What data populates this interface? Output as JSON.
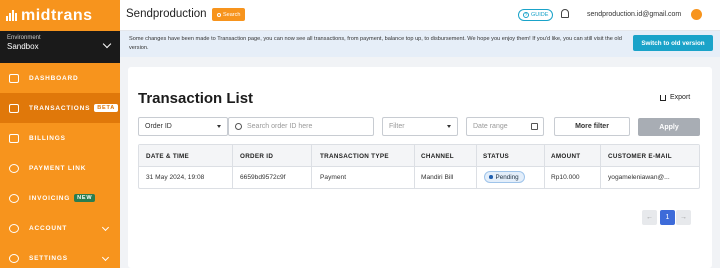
{
  "sidebar": {
    "logo_text": "midtrans",
    "environment_label": "Environment",
    "environment_value": "Sandbox",
    "items": [
      {
        "label": "DASHBOARD"
      },
      {
        "label": "TRANSACTIONS",
        "badge": "BETA"
      },
      {
        "label": "BILLINGS"
      },
      {
        "label": "PAYMENT LINK"
      },
      {
        "label": "INVOICING",
        "badge": "NEW"
      },
      {
        "label": "ACCOUNT"
      },
      {
        "label": "SETTINGS"
      }
    ]
  },
  "topbar": {
    "title": "Sendproduction",
    "search_label": "Search",
    "guide_label": "GUIDE",
    "email": "sendproduction.id@gmail.com"
  },
  "notice": {
    "text": "Some changes have been made to Transaction page, you can now see all transactions, from payment, balance top up, to disbursement. We hope you enjoy them! If you'd like, you can still visit the old version.",
    "button": "Switch to old version"
  },
  "main": {
    "title": "Transaction List",
    "export_label": "Export",
    "filters": {
      "order_select": "Order ID",
      "search_placeholder": "Search order ID here",
      "filter_select": "Filter",
      "date_placeholder": "Date range",
      "more_filter": "More filter",
      "apply": "Apply"
    },
    "table": {
      "headers": [
        "DATE & TIME",
        "ORDER ID",
        "TRANSACTION TYPE",
        "CHANNEL",
        "STATUS",
        "AMOUNT",
        "CUSTOMER E-MAIL"
      ],
      "rows": [
        [
          "31 May 2024, 19:08",
          "6659bd9572c9f",
          "Payment",
          "Mandiri Bill",
          "Pending",
          "Rp10.000",
          "yogameleniawan@..."
        ]
      ]
    },
    "pagination": {
      "prev": "←",
      "current": "1",
      "next": "→"
    }
  },
  "colors": {
    "brand": "#f7941d",
    "accent": "#1aa3c9",
    "pager_active": "#3d6bd9"
  }
}
